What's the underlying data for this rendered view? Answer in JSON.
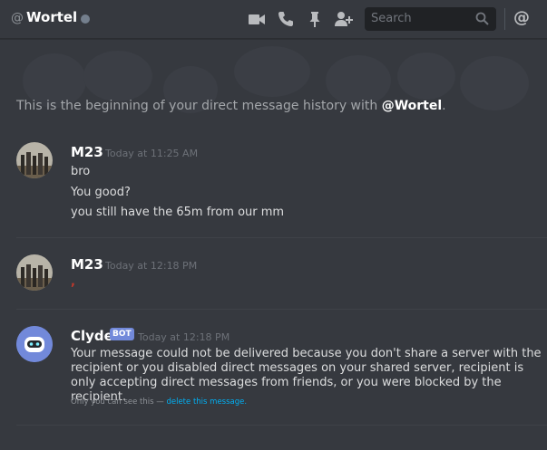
{
  "header": {
    "at_symbol": "@",
    "title": "Wortel",
    "status": "offline",
    "search_placeholder": "Search",
    "mention_symbol": "@",
    "icons": [
      "video-call-icon",
      "phone-call-icon",
      "pin-icon",
      "add-friend-icon",
      "search-icon",
      "mention-icon"
    ]
  },
  "beginning": {
    "prefix": "This is the beginning of your direct message history with ",
    "handle": "@Wortel",
    "suffix": "."
  },
  "messages": [
    {
      "author": "M23",
      "timestamp": "Today at 11:25 AM",
      "lines": [
        "bro",
        "You good?",
        "you still have the 65m from our mm"
      ]
    },
    {
      "author": "M23",
      "timestamp": "Today at 12:18 PM",
      "lines": [
        ","
      ]
    },
    {
      "author": "Clyde",
      "badge": "BOT",
      "timestamp": "Today at 12:18 PM",
      "text": "Your message could not be delivered because you don't share a server with the recipient or you disabled direct messages on your shared server, recipient is only accepting direct messages from friends, or you were blocked by the recipient.",
      "ephemeral_note": "Only you can see this — ",
      "ephemeral_link": "delete this message."
    }
  ],
  "colors": {
    "background": "#36393f",
    "header_text": "#ffffff",
    "muted": "#a3a6aa",
    "bot_badge": "#7289da",
    "link": "#00b0f4",
    "clyde_avatar": "#7289da",
    "comma_red": "#c0392b"
  }
}
